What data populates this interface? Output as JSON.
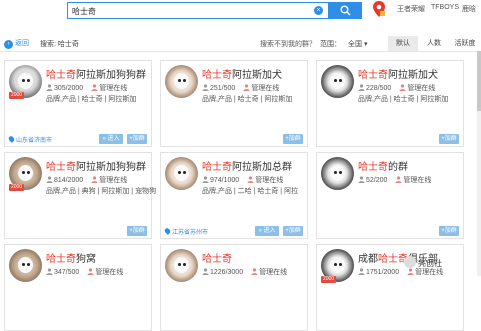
{
  "search": {
    "value": "哈士奇",
    "clear_glyph": "×"
  },
  "top_links": [
    "王者荣耀",
    "TFBOYS",
    "鹿晗"
  ],
  "filter": {
    "back": "返回",
    "back_glyph": "‹",
    "search_label": "搜索: 哈士奇",
    "not_found": "搜索不到我的群？",
    "range_label": "范围：",
    "range_value": "全国",
    "range_arrow": "▾",
    "tabs": [
      "默认",
      "人数",
      "活跃度"
    ],
    "active_tab": "默认"
  },
  "groups": [
    {
      "title_hl": "哈士奇",
      "title_rest": "阿拉斯加狗狗群",
      "members": "305/2000",
      "manager": "管理在线",
      "tags": "品牌,产品 | 哈士奇 | 阿拉斯加",
      "location": "山东省济南市",
      "year": "2000",
      "enter": "» 进入",
      "join": "+加群"
    },
    {
      "title_hl": "哈士奇",
      "title_rest": "阿拉斯加犬",
      "members": "251/500",
      "manager": "管理在线",
      "tags": "品牌,产品 | 哈士奇 | 阿拉斯加",
      "location": "",
      "year": "",
      "enter": "",
      "join": "+加群"
    },
    {
      "title_hl": "哈士奇",
      "title_rest": "阿拉斯加犬",
      "members": "228/500",
      "manager": "管理在线",
      "tags": "品牌,产品 | 哈士奇 | 阿拉斯加",
      "location": "",
      "year": "",
      "enter": "",
      "join": "+加群"
    },
    {
      "title_hl": "哈士奇",
      "title_rest": "阿拉斯加狗狗群",
      "members": "814/2000",
      "manager": "管理在线",
      "tags": "品牌,产品 | 典狗 | 阿拉斯加 | 宠物狗",
      "location": "",
      "year": "2000",
      "enter": "",
      "join": "+加群"
    },
    {
      "title_hl": "哈士奇",
      "title_rest": "阿拉斯加总群",
      "members": "974/1000",
      "manager": "管理在线",
      "tags": "品牌,产品 | 二哈 | 哈士奇 | 阿拉",
      "location": "江苏省苏州市",
      "year": "",
      "enter": "» 进入",
      "join": "+加群"
    },
    {
      "title_hl": "哈士奇",
      "title_rest": "的群",
      "members": "52/200",
      "manager": "管理在线",
      "tags": "",
      "location": "",
      "year": "",
      "enter": "",
      "join": "+加群"
    },
    {
      "title_hl": "哈士奇",
      "title_rest": "狗窝",
      "members": "347/500",
      "manager": "管理在线",
      "tags": "",
      "location": "",
      "year": "",
      "enter": "",
      "join": ""
    },
    {
      "title_hl": "哈士奇",
      "title_rest": "",
      "members": "1226/3000",
      "manager": "管理在线",
      "tags": "",
      "location": "",
      "year": "",
      "enter": "",
      "join": ""
    },
    {
      "title_pre": "成都",
      "title_hl": "哈士奇",
      "title_rest": "俱乐部",
      "members": "1751/2000",
      "manager": "管理在线",
      "tags": "",
      "location": "",
      "year": "2000",
      "enter": "",
      "join": ""
    }
  ],
  "watermark": "亮创社"
}
